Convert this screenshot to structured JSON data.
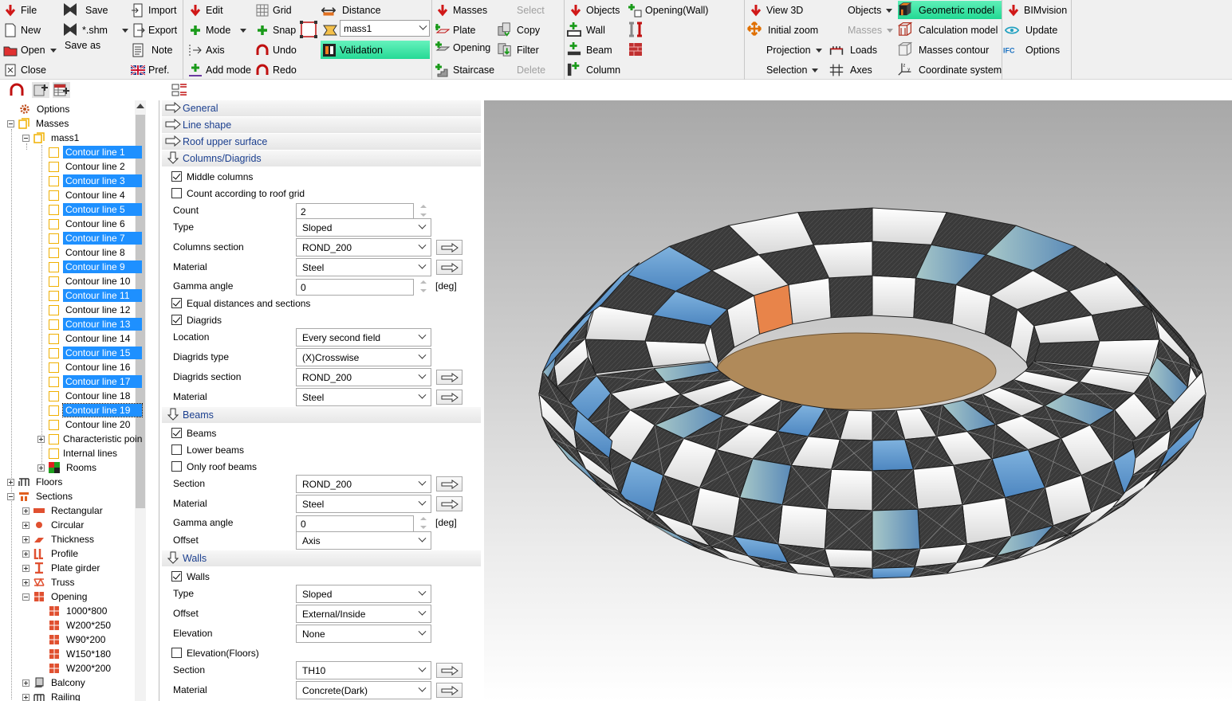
{
  "ribbon": {
    "file": "File",
    "new": "New",
    "open": "Open",
    "close": "Close",
    "save": "Save",
    "shm": "*.shm",
    "save_as": "Save as",
    "import": "Import",
    "export": "Export",
    "note": "Note",
    "pref": "Pref.",
    "edit": "Edit",
    "mode": "Mode",
    "axis": "Axis",
    "add_mode": "Add mode",
    "grid": "Grid",
    "snap": "Snap",
    "undo": "Undo",
    "redo": "Redo",
    "distance": "Distance",
    "mass_combo": "mass1",
    "validation": "Validation",
    "masses": "Masses",
    "select": "Select",
    "plate": "Plate",
    "copy": "Copy",
    "opening": "Opening",
    "filter": "Filter",
    "staircase": "Staircase",
    "delete": "Delete",
    "objects": "Objects",
    "opening_wall": "Opening(Wall)",
    "wall": "Wall",
    "beam": "Beam",
    "column": "Column",
    "view3d": "View 3D",
    "initial_zoom": "Initial zoom",
    "projection": "Projection",
    "selection": "Selection",
    "objects2": "Objects",
    "masses2": "Masses",
    "loads": "Loads",
    "axes": "Axes",
    "geometric_model": "Geometric model",
    "calculation_model": "Calculation model",
    "masses_contour": "Masses contour",
    "coordinate_system": "Coordinate system",
    "bimvision": "BIMvision",
    "update": "Update",
    "options": "Options"
  },
  "tree": {
    "options": "Options",
    "masses": "Masses",
    "mass1": "mass1",
    "contours": [
      "Contour line 1",
      "Contour line 2",
      "Contour line 3",
      "Contour line 4",
      "Contour line 5",
      "Contour line 6",
      "Contour line 7",
      "Contour line 8",
      "Contour line 9",
      "Contour line 10",
      "Contour line 11",
      "Contour line 12",
      "Contour line 13",
      "Contour line 14",
      "Contour line 15",
      "Contour line 16",
      "Contour line 17",
      "Contour line 18",
      "Contour line 19",
      "Contour line 20"
    ],
    "characteristic": "Characteristic poin",
    "internal_lines": "Internal lines",
    "rooms": "Rooms",
    "floors": "Floors",
    "sections": "Sections",
    "rectangular": "Rectangular",
    "circular": "Circular",
    "thickness": "Thickness",
    "profile": "Profile",
    "plate_girder": "Plate girder",
    "truss": "Truss",
    "opening": "Opening",
    "openings": [
      "1000*800",
      "W200*250",
      "W90*200",
      "W150*180",
      "W200*200"
    ],
    "balcony": "Balcony",
    "railing": "Railing"
  },
  "props": {
    "sections": {
      "general": "General",
      "line_shape": "Line shape",
      "roof_upper": "Roof upper surface",
      "columns": "Columns/Diagrids",
      "beams": "Beams",
      "walls": "Walls"
    },
    "middle_columns": "Middle columns",
    "count_roof_grid": "Count according to roof grid",
    "count_label": "Count",
    "count_value": "2",
    "type_label": "Type",
    "type_value": "Sloped",
    "col_section_label": "Columns section",
    "col_section_value": "ROND_200",
    "material_label": "Material",
    "material_value": "Steel",
    "gamma_label": "Gamma angle",
    "gamma_value": "0",
    "deg": "[deg]",
    "equal_dist": "Equal distances and sections",
    "diagrids": "Diagrids",
    "location_label": "Location",
    "location_value": "Every second field",
    "diag_type_label": "Diagrids type",
    "diag_type_value": "(X)Crosswise",
    "diag_section_label": "Diagrids section",
    "diag_section_value": "ROND_200",
    "diag_material_value": "Steel",
    "beams_chk": "Beams",
    "lower_beams": "Lower beams",
    "only_roof_beams": "Only roof beams",
    "beam_section_label": "Section",
    "beam_section_value": "ROND_200",
    "beam_material_value": "Steel",
    "beam_gamma_value": "0",
    "offset_label": "Offset",
    "beam_offset_value": "Axis",
    "walls_chk": "Walls",
    "wall_type_value": "Sloped",
    "wall_offset_value": "External/Inside",
    "elevation_label": "Elevation",
    "elevation_value": "None",
    "elevation_floors": "Elevation(Floors)",
    "wall_section_value": "TH10",
    "wall_material_value": "Concrete(Dark)"
  },
  "colors": {
    "accent_green": "#22d893",
    "selection_blue": "#1e90ff",
    "section_text": "#1b3f8f"
  }
}
